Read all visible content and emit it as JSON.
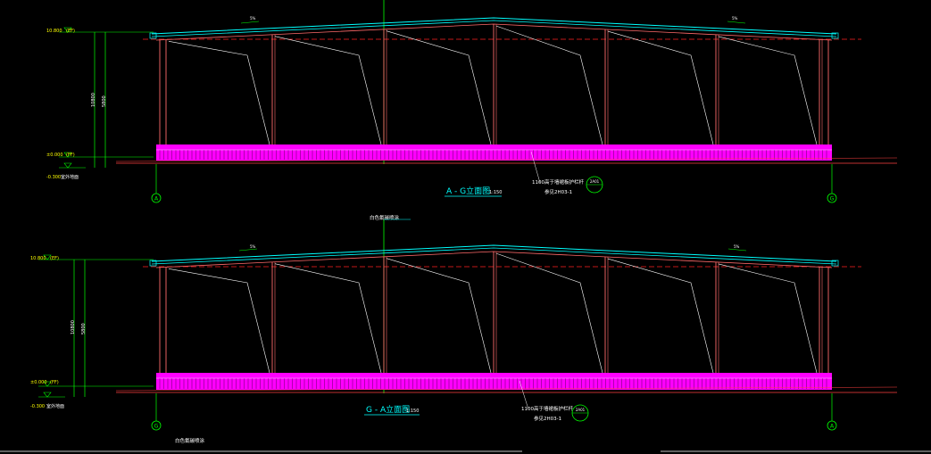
{
  "colors": {
    "background": "#000000",
    "frame": "#ff6a6a",
    "roof_cyan": "#00ffff",
    "brace": "#ffffff",
    "axis_green": "#00ff00",
    "wall_magenta": "#ff00ff",
    "ground": "#ff4040",
    "dash_red": "#ff2020"
  },
  "elevation_top": {
    "title": "A - G立面图",
    "scale": "1:150",
    "eave_level": "10.800",
    "eave_level_tag": "(EF)",
    "floor_level": "±0.000",
    "floor_level_tag": "(FF)",
    "ground_level": "-0.300",
    "ground_level_label": "室外地面",
    "total_height": "10800",
    "sub_height": "5800",
    "left_axis": "A",
    "right_axis": "G",
    "slope_left": "5%",
    "slope_right": "5%",
    "note_line1": "高于墙裙板护栏杆",
    "note_line2": "参见2H03-1",
    "note_index": "2A01",
    "note_num": "1100"
  },
  "elevation_bottom": {
    "title": "G - A立面图",
    "scale": "1:150",
    "top_note": "白色氟碳喷涂",
    "eave_level": "10.800",
    "eave_level_tag": "(EF)",
    "floor_level": "±0.000",
    "floor_level_tag": "(FF)",
    "ground_level": "-0.300",
    "ground_level_label": "室外地面",
    "total_height": "10800",
    "sub_height": "5800",
    "left_axis": "G",
    "right_axis": "A",
    "slope_left": "5%",
    "slope_right": "5%",
    "note_line1": "高于墙裙板护栏杆",
    "note_line2": "参见2H03-1",
    "note_index": "2A01",
    "note_num": "1100",
    "bottom_note": "白色氟碳喷涂"
  }
}
